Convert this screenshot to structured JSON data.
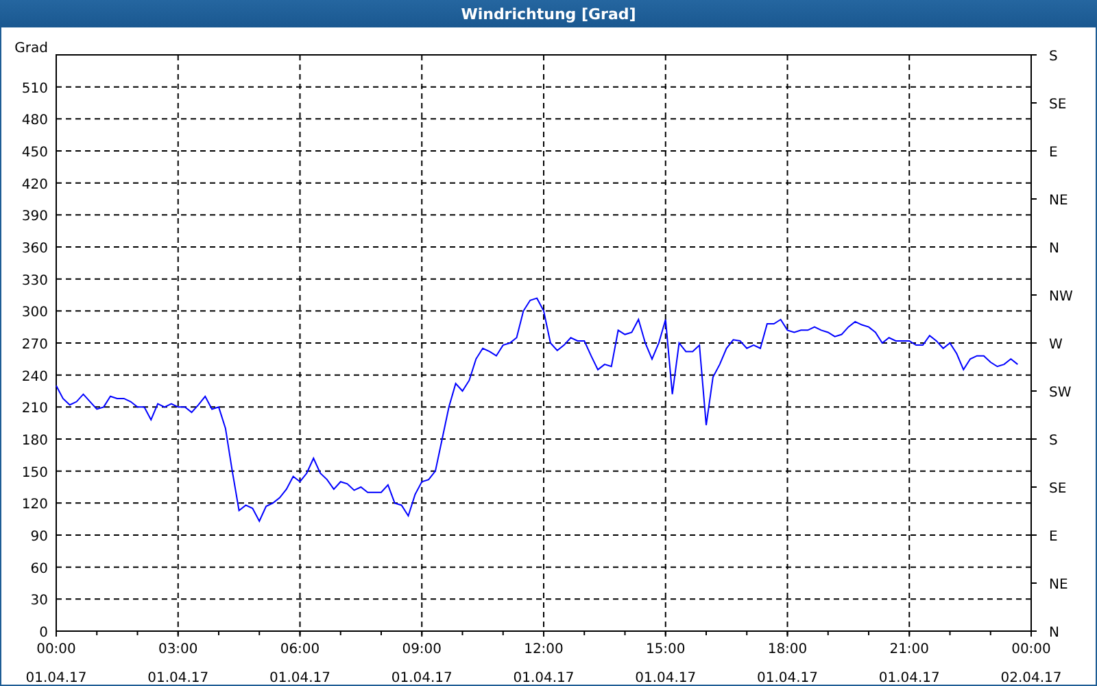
{
  "window": {
    "title": "Windrichtung [Grad]"
  },
  "chart": {
    "chart_data": {
      "type": "line",
      "grid": true,
      "ylabel": "Grad",
      "ylim": [
        0,
        540
      ],
      "categories": [
        "00:00\n01.04.17",
        null,
        null,
        null,
        null,
        null,
        null,
        null,
        null,
        null,
        null,
        null,
        null,
        null,
        null,
        null,
        null,
        null,
        "03:00\n01.04.17",
        null,
        null,
        null,
        null,
        null,
        null,
        null,
        null,
        null,
        null,
        null,
        null,
        null,
        null,
        null,
        null,
        null,
        "06:00\n01.04.17",
        null,
        null,
        null,
        null,
        null,
        null,
        null,
        null,
        null,
        null,
        null,
        null,
        null,
        null,
        null,
        null,
        null,
        "09:00\n01.04.17",
        null,
        null,
        null,
        null,
        null,
        null,
        null,
        null,
        null,
        null,
        null,
        null,
        null,
        null,
        null,
        null,
        null,
        "12:00\n01.04.17",
        null,
        null,
        null,
        null,
        null,
        null,
        null,
        null,
        null,
        null,
        null,
        null,
        null,
        null,
        null,
        null,
        null,
        "15:00\n01.04.17",
        null,
        null,
        null,
        null,
        null,
        null,
        null,
        null,
        null,
        null,
        null,
        null,
        null,
        null,
        null,
        null,
        null,
        "18:00\n01.04.17",
        null,
        null,
        null,
        null,
        null,
        null,
        null,
        null,
        null,
        null,
        null,
        null,
        null,
        null,
        null,
        null,
        null,
        "21:00\n01.04.17",
        null,
        null,
        null,
        null,
        null,
        null,
        null,
        null,
        null,
        null,
        null,
        null,
        null,
        null,
        null,
        null,
        null,
        "00:00\n02.04.17"
      ],
      "yticks": [
        0,
        30,
        60,
        90,
        120,
        150,
        180,
        210,
        240,
        270,
        300,
        330,
        360,
        390,
        420,
        450,
        480,
        510
      ],
      "series": [
        {
          "color": "#0000ff",
          "values": [
            230,
            218,
            212,
            215,
            222,
            215,
            208,
            210,
            220,
            218,
            218,
            215,
            210,
            210,
            198,
            213,
            210,
            213,
            210,
            210,
            205,
            212,
            220,
            208,
            210,
            190,
            150,
            113,
            118,
            115,
            103,
            117,
            120,
            125,
            133,
            145,
            140,
            148,
            162,
            148,
            142,
            133,
            140,
            138,
            132,
            135,
            130,
            130,
            130,
            137,
            120,
            118,
            108,
            128,
            140,
            142,
            150,
            180,
            210,
            232,
            225,
            235,
            255,
            265,
            262,
            258,
            268,
            270,
            275,
            300,
            310,
            312,
            300,
            270,
            263,
            268,
            275,
            272,
            272,
            258,
            245,
            250,
            248,
            282,
            278,
            280,
            292,
            270,
            255,
            270,
            292,
            222,
            270,
            262,
            262,
            268,
            193,
            238,
            250,
            265,
            273,
            272,
            265,
            268,
            265,
            288,
            288,
            292,
            282,
            280,
            282,
            282,
            285,
            282,
            280,
            276,
            278,
            285,
            290,
            287,
            285,
            280,
            270,
            275,
            272,
            272,
            272,
            268,
            268,
            277,
            272,
            265,
            270,
            260,
            245,
            255,
            258,
            258,
            252,
            248,
            250,
            255,
            250,
            null,
            null
          ]
        }
      ]
    },
    "secondary_yticks": [
      "S",
      "SE",
      "E",
      "NE",
      "N",
      "NW",
      "W",
      "SW",
      "S",
      "SE",
      "E",
      "NE",
      "N"
    ]
  }
}
